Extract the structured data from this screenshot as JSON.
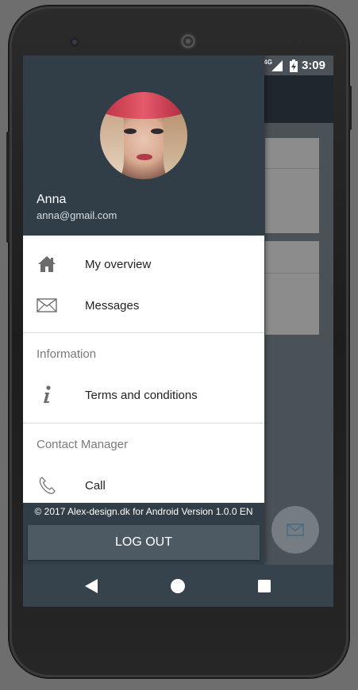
{
  "status_bar": {
    "network": "4G",
    "time": "3:09"
  },
  "drawer": {
    "user": {
      "name": "Anna",
      "email": "anna@gmail.com"
    },
    "items": [
      {
        "label": "My overview",
        "icon": "home-icon"
      },
      {
        "label": "Messages",
        "icon": "envelope-icon"
      }
    ],
    "sections": [
      {
        "title": "Information",
        "items": [
          {
            "label": "Terms and conditions",
            "icon": "info-icon"
          }
        ]
      },
      {
        "title": "Contact Manager",
        "items": [
          {
            "label": "Call",
            "icon": "phone-icon"
          }
        ]
      }
    ],
    "footer_text": "© 2017 Alex-design.dk for Android Version 1.0.0 EN",
    "logout_label": "LOG OUT"
  },
  "colors": {
    "header_bg": "#323e47",
    "logout_bg": "#4d5a64",
    "navbar_bg": "#36434d"
  }
}
